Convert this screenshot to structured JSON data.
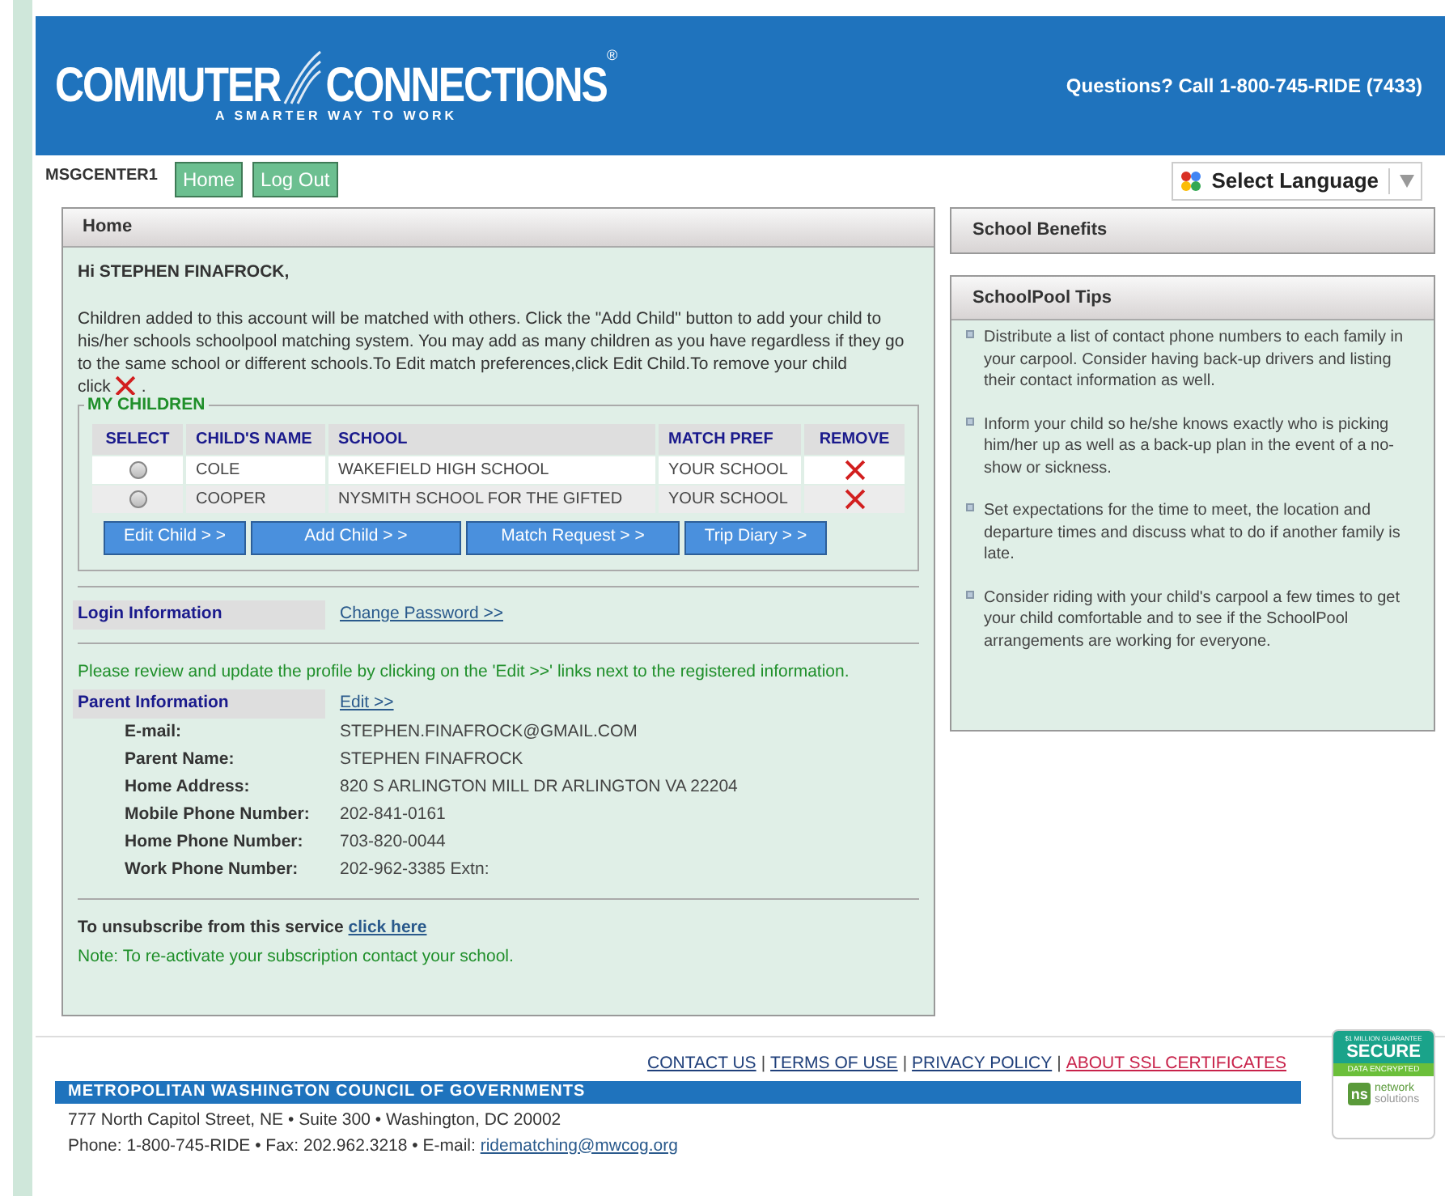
{
  "header": {
    "logo": {
      "name_left": "COMMUTER",
      "name_right": "CONNECTIONS",
      "trademark": "®",
      "tagline": "A SMARTER WAY TO WORK"
    },
    "phone": "Questions? Call 1-800-745-RIDE (7433)"
  },
  "nav": {
    "user": "MSGCENTER1",
    "buttons": [
      "Home",
      "Log Out"
    ],
    "language": "Select Language"
  },
  "main": {
    "title": "Home",
    "greeting": "Hi STEPHEN FINAFROCK,",
    "intro": "Children added to this account will be matched with others. Click the \"Add Child\" button to add your child to his/her schools schoolpool matching system. You may add as many children as you have regardless if they go to the same school or different schools.To Edit match preferences,click Edit Child.To remove your child",
    "intro_tail": "click",
    "intro_end": ".",
    "children": {
      "legend": "MY CHILDREN",
      "columns": [
        "SELECT",
        "CHILD'S NAME",
        "SCHOOL",
        "MATCH PREF",
        "REMOVE"
      ],
      "rows": [
        {
          "selected": false,
          "name": "COLE",
          "school": "WAKEFIELD HIGH SCHOOL",
          "match_pref": "YOUR SCHOOL"
        },
        {
          "selected": false,
          "name": "COOPER",
          "school": "NYSMITH SCHOOL FOR THE GIFTED",
          "match_pref": "YOUR SCHOOL"
        }
      ],
      "buttons": [
        "Edit Child > >",
        "Add Child > >",
        "Match Request > >",
        "Trip Diary > >"
      ]
    },
    "login": {
      "label": "Login Information",
      "link": "Change Password >>"
    },
    "notice": "Please review and update the profile by clicking on the 'Edit >>' links next to the registered information.",
    "parent": {
      "label": "Parent Information",
      "link": "Edit >>",
      "fields": [
        {
          "label": "E-mail:",
          "value": "STEPHEN.FINAFROCK@GMAIL.COM"
        },
        {
          "label": "Parent Name:",
          "value": "STEPHEN FINAFROCK"
        },
        {
          "label": "Home Address:",
          "value": "820 S ARLINGTON MILL DR ARLINGTON VA 22204"
        },
        {
          "label": "Mobile Phone Number:",
          "value": "202-841-0161"
        },
        {
          "label": "Home Phone Number:",
          "value": "703-820-0044"
        },
        {
          "label": "Work Phone Number:",
          "value": "202-962-3385 Extn:"
        }
      ]
    },
    "unsubscribe": {
      "text": "To unsubscribe from this service",
      "link": "click here"
    },
    "note": "Note: To re-activate your subscription contact your school."
  },
  "sidebar": {
    "benefits_title": "School Benefits",
    "tips_title": "SchoolPool Tips",
    "tips": [
      "Distribute a list of contact phone numbers to each family in your carpool. Consider having back-up drivers and listing their contact information as well.",
      "Inform your child so he/she knows exactly who is picking him/her up as well as a back-up plan in the event of a no-show or sickness.",
      "Set expectations for the time to meet, the location and departure times and discuss what to do if another family is late.",
      "Consider riding with your child's carpool a few times to get your child comfortable and to see if the SchoolPool arrangements are working for everyone."
    ]
  },
  "footer": {
    "links": [
      {
        "label": "CONTACT US",
        "color": "#1f3f7a"
      },
      {
        "label": "TERMS OF USE",
        "color": "#1f3f7a"
      },
      {
        "label": "PRIVACY POLICY",
        "color": "#1f3f7a"
      },
      {
        "label": "ABOUT SSL CERTIFICATES",
        "color": "#c8224a"
      }
    ],
    "separator": "|",
    "org": "METROPOLITAN WASHINGTON COUNCIL OF GOVERNMENTS",
    "address": "777 North Capitol Street, NE • Suite 300 • Washington, DC 20002",
    "contact": "Phone: 1-800-745-RIDE • Fax: 202.962.3218 • E-mail:",
    "email": "ridematching@mwcog.org"
  },
  "seal": {
    "guarantee": "$1 MILLION GUARANTEE",
    "secure": "SECURE",
    "encrypted": "DATA ENCRYPTED",
    "badge": "ns",
    "brand_top": "network",
    "brand_bottom": "solutions"
  }
}
